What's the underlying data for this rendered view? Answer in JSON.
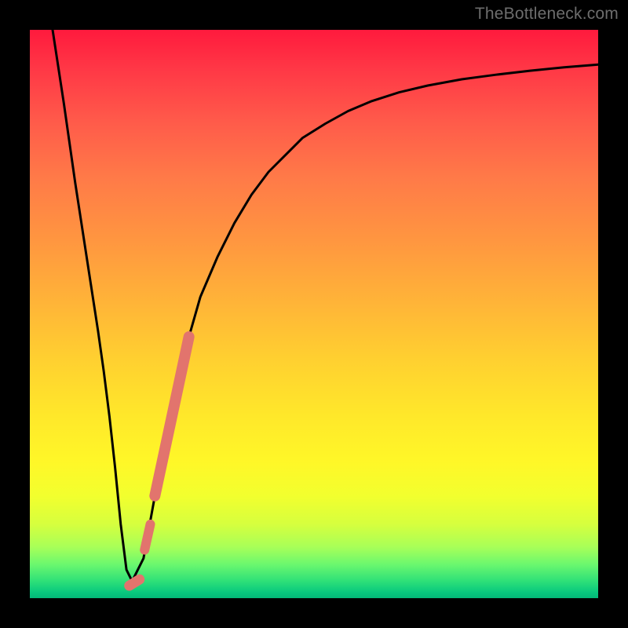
{
  "watermark": "TheBottleneck.com",
  "chart_data": {
    "type": "line",
    "title": "",
    "xlabel": "",
    "ylabel": "",
    "xlim": [
      0,
      100
    ],
    "ylim": [
      0,
      100
    ],
    "grid": false,
    "curve": {
      "name": "bottleneck-curve",
      "color": "#000000",
      "x": [
        4,
        6,
        8,
        10,
        12,
        13,
        14,
        15,
        16,
        17,
        18,
        20,
        22,
        24,
        26,
        28,
        30,
        33,
        36,
        39,
        42,
        45,
        48,
        52,
        56,
        60,
        65,
        70,
        76,
        82,
        88,
        94,
        100
      ],
      "y": [
        100,
        87,
        73,
        60,
        47,
        40,
        32,
        23,
        13,
        5,
        3,
        7,
        18,
        29,
        38,
        46,
        53,
        60,
        66,
        71,
        75,
        78,
        81,
        83.5,
        85.7,
        87.4,
        89,
        90.2,
        91.3,
        92.1,
        92.8,
        93.4,
        93.9
      ]
    },
    "overlay_segments": [
      {
        "name": "thick-pink-segment",
        "color": "#e2746d",
        "width": 14,
        "x": [
          22,
          28
        ],
        "y": [
          18,
          46
        ]
      },
      {
        "name": "short-pink-dot-upper",
        "color": "#e2746d",
        "width": 12,
        "x": [
          20.2,
          21.2
        ],
        "y": [
          8.5,
          13
        ]
      },
      {
        "name": "short-pink-dot-lower",
        "color": "#e2746d",
        "width": 13,
        "x": [
          17.5,
          19.3
        ],
        "y": [
          2.2,
          3.3
        ]
      }
    ]
  }
}
